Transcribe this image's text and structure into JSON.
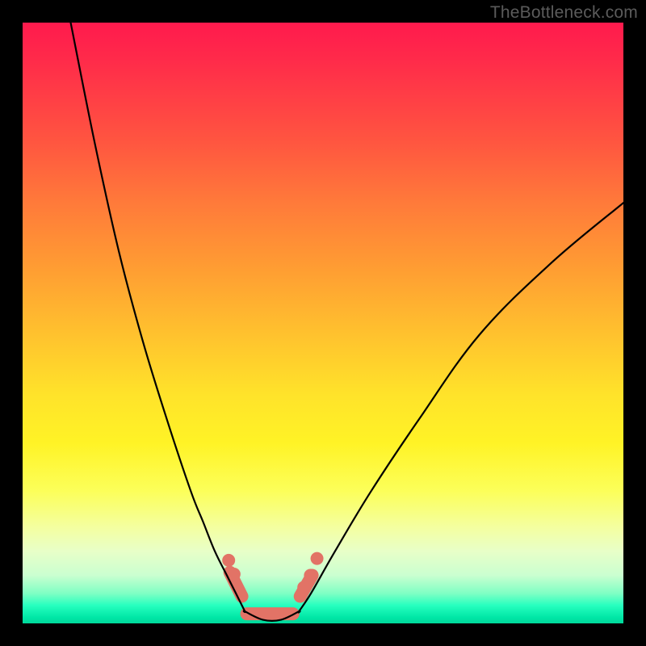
{
  "watermark": "TheBottleneck.com",
  "chart_data": {
    "type": "line",
    "title": "",
    "xlabel": "",
    "ylabel": "",
    "xlim": [
      0,
      100
    ],
    "ylim": [
      0,
      100
    ],
    "series": [
      {
        "name": "left-curve",
        "x": [
          8,
          12,
          16,
          20,
          24,
          28,
          30,
          32,
          34,
          35,
          36,
          37
        ],
        "y": [
          100,
          80,
          62,
          47,
          34,
          22,
          17,
          12,
          8,
          6,
          4,
          2
        ]
      },
      {
        "name": "valley",
        "x": [
          37,
          40,
          43,
          46
        ],
        "y": [
          2,
          0.6,
          0.6,
          2
        ]
      },
      {
        "name": "right-curve",
        "x": [
          46,
          48,
          52,
          58,
          66,
          76,
          88,
          100
        ],
        "y": [
          2,
          5,
          12,
          22,
          34,
          48,
          60,
          70
        ]
      }
    ],
    "markers": {
      "name": "salmon-highlight",
      "color": "#e27366",
      "segments": [
        {
          "x": [
            34.5,
            36.5
          ],
          "y": [
            8.5,
            4.5
          ]
        },
        {
          "x": [
            37.3,
            45.0
          ],
          "y": [
            1.6,
            1.6
          ]
        },
        {
          "x": [
            46.2,
            48.2
          ],
          "y": [
            4.5,
            8.0
          ]
        }
      ],
      "dots": [
        {
          "x": 34.3,
          "y": 10.5
        },
        {
          "x": 35.2,
          "y": 8.2
        },
        {
          "x": 46.8,
          "y": 6.0
        },
        {
          "x": 47.9,
          "y": 8.0
        },
        {
          "x": 49.0,
          "y": 10.8
        }
      ]
    }
  }
}
